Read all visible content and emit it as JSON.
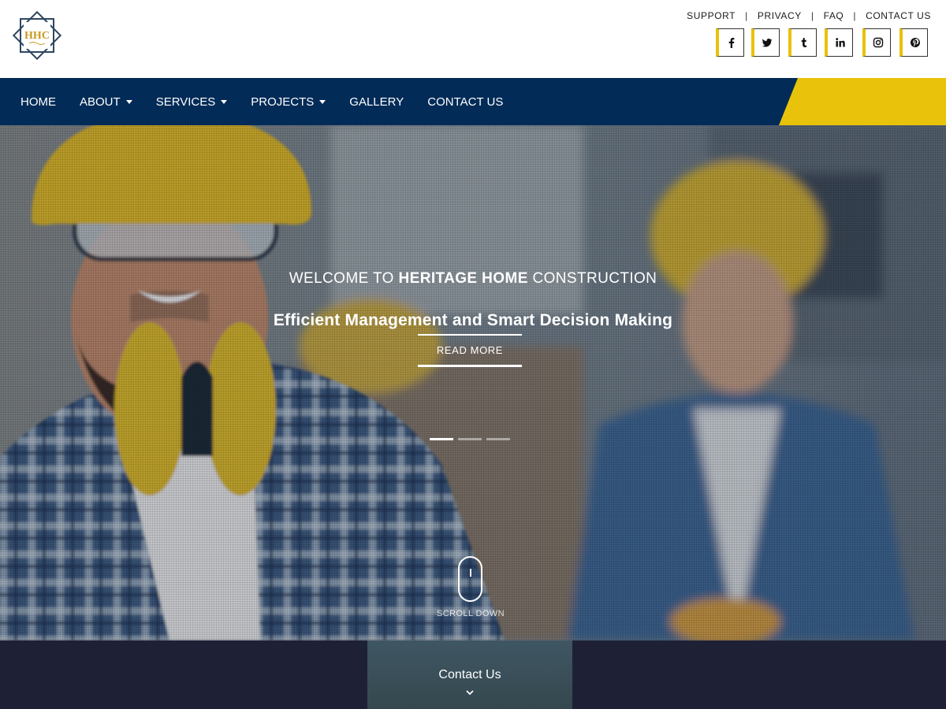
{
  "brand": {
    "logo_text": "HHC",
    "logo_icon": "diamond-badge-logo",
    "accent_yellow": "#e9c20b",
    "navy": "#022b57"
  },
  "top_links": [
    {
      "label": "SUPPORT"
    },
    {
      "label": "PRIVACY"
    },
    {
      "label": "FAQ"
    },
    {
      "label": "CONTACT US"
    }
  ],
  "top_links_separator": "|",
  "social": [
    {
      "icon": "facebook-icon",
      "glyph": "f"
    },
    {
      "icon": "twitter-icon",
      "glyph": "bird"
    },
    {
      "icon": "tumblr-icon",
      "glyph": "t"
    },
    {
      "icon": "linkedin-icon",
      "glyph": "in"
    },
    {
      "icon": "instagram-icon",
      "glyph": "camera"
    },
    {
      "icon": "pinterest-icon",
      "glyph": "p"
    }
  ],
  "nav": {
    "items": [
      {
        "label": "HOME",
        "dropdown": false
      },
      {
        "label": "ABOUT",
        "dropdown": true
      },
      {
        "label": "SERVICES",
        "dropdown": true
      },
      {
        "label": "PROJECTS",
        "dropdown": true
      },
      {
        "label": "GALLERY",
        "dropdown": false
      },
      {
        "label": "CONTACT US",
        "dropdown": false
      }
    ]
  },
  "hero": {
    "welcome_prefix": "WELCOME TO ",
    "welcome_bold": "HERITAGE HOME",
    "welcome_suffix": " CONSTRUCTION",
    "headline": "Efficient Management and Smart Decision Making",
    "cta_label": "READ MORE",
    "slides_total": 3,
    "active_slide": 1,
    "scroll_label": "SCROLL DOWN"
  },
  "bottom": {
    "contact_tab_label": "Contact Us",
    "contact_tab_icon": "chevron-down-icon"
  }
}
